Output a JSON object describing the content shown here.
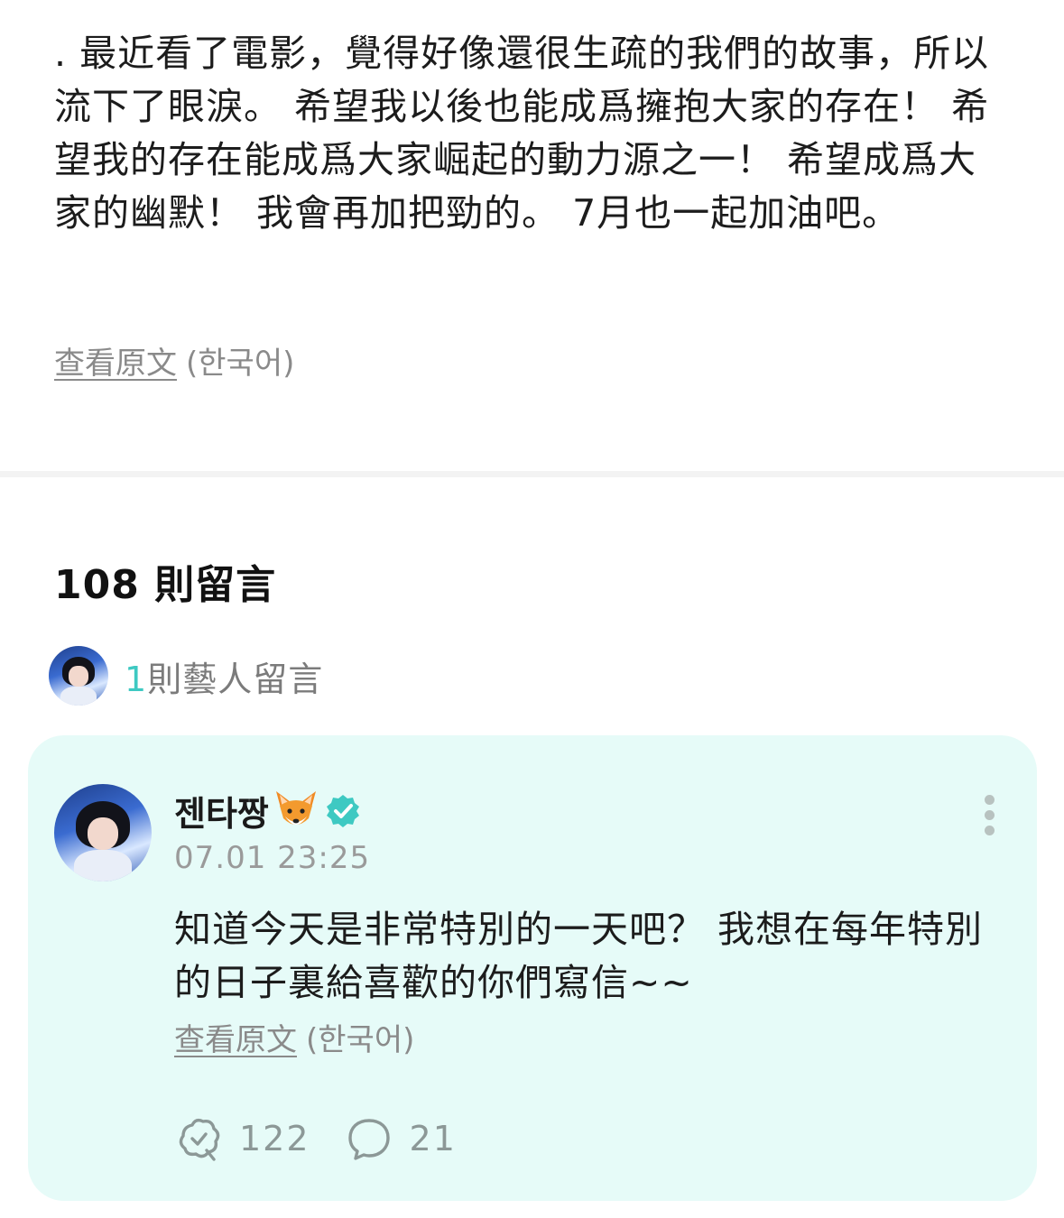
{
  "post": {
    "body": ". 最近看了電影，覺得好像還很生疏的我們的故事，所以流下了眼淚。 希望我以後也能成爲擁抱大家的存在！ 希望我的存在能成爲大家崛起的動力源之一！ 希望成爲大家的幽默！ 我會再加把勁的。 7月也一起加油吧。",
    "translate_link": "查看原文",
    "translate_lang": "(한국어)"
  },
  "comments": {
    "title": "108 則留言",
    "artist_summary": {
      "count": "1",
      "label": "則藝人留言"
    },
    "featured": {
      "author": "젠타짱",
      "author_emoji_icon": "fox-face-icon",
      "verified_icon": "verified-badge-icon",
      "timestamp": "07.01 23:25",
      "text": "知道今天是非常特別的一天吧？ 我想在每年特別的日子裏給喜歡的你們寫信~~",
      "translate_link": "查看原文",
      "translate_lang": "(한국어)",
      "likes": "122",
      "replies": "21"
    }
  },
  "colors": {
    "accent": "#3ec9c2",
    "card_background": "#e6fbf8",
    "muted_text": "#8a8a8a"
  }
}
